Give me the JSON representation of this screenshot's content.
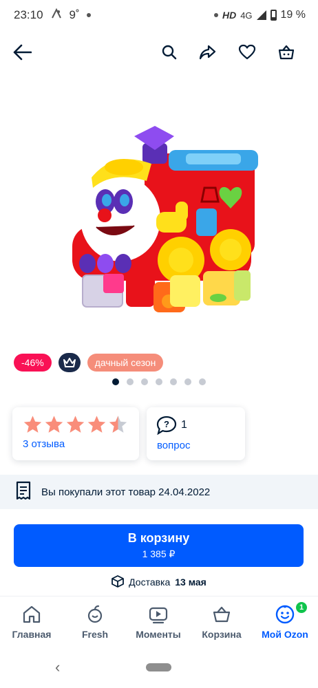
{
  "status_bar": {
    "time": "23:10",
    "temperature": "9˚",
    "network": "HD",
    "signal_label": "4G",
    "battery": "19 %"
  },
  "top_nav": {
    "back_icon": "arrow-left-icon",
    "icons": [
      "search-icon",
      "share-icon",
      "heart-icon",
      "cart-icon"
    ]
  },
  "product": {
    "image_icon": "toy-train-photo"
  },
  "badges": {
    "discount": "-46%",
    "premium_icon": "crown-icon",
    "season": "дачный сезон",
    "discount_color": "#f91155",
    "season_color": "#f58d7a"
  },
  "carousel": {
    "total": 7,
    "active_index": 0
  },
  "rating_card": {
    "rating": 4.5,
    "max": 5,
    "reviews_label": "3 отзыва",
    "star_color": "#f98d7a"
  },
  "questions_card": {
    "count": "1",
    "label": "вопрос"
  },
  "purchase_notice": {
    "text": "Вы покупали этот товар 24.04.2022"
  },
  "cart_button": {
    "label": "В корзину",
    "price": "1 385 ₽",
    "color": "#005bff"
  },
  "delivery": {
    "prefix": "Доставка",
    "date": "13 мая"
  },
  "tab_bar": {
    "tabs": [
      {
        "label": "Главная",
        "icon": "home-icon"
      },
      {
        "label": "Fresh",
        "icon": "fresh-icon"
      },
      {
        "label": "Моменты",
        "icon": "moments-icon"
      },
      {
        "label": "Корзина",
        "icon": "basket-icon"
      },
      {
        "label": "Мой Ozon",
        "icon": "smile-icon",
        "badge": "1",
        "active": true
      }
    ]
  }
}
